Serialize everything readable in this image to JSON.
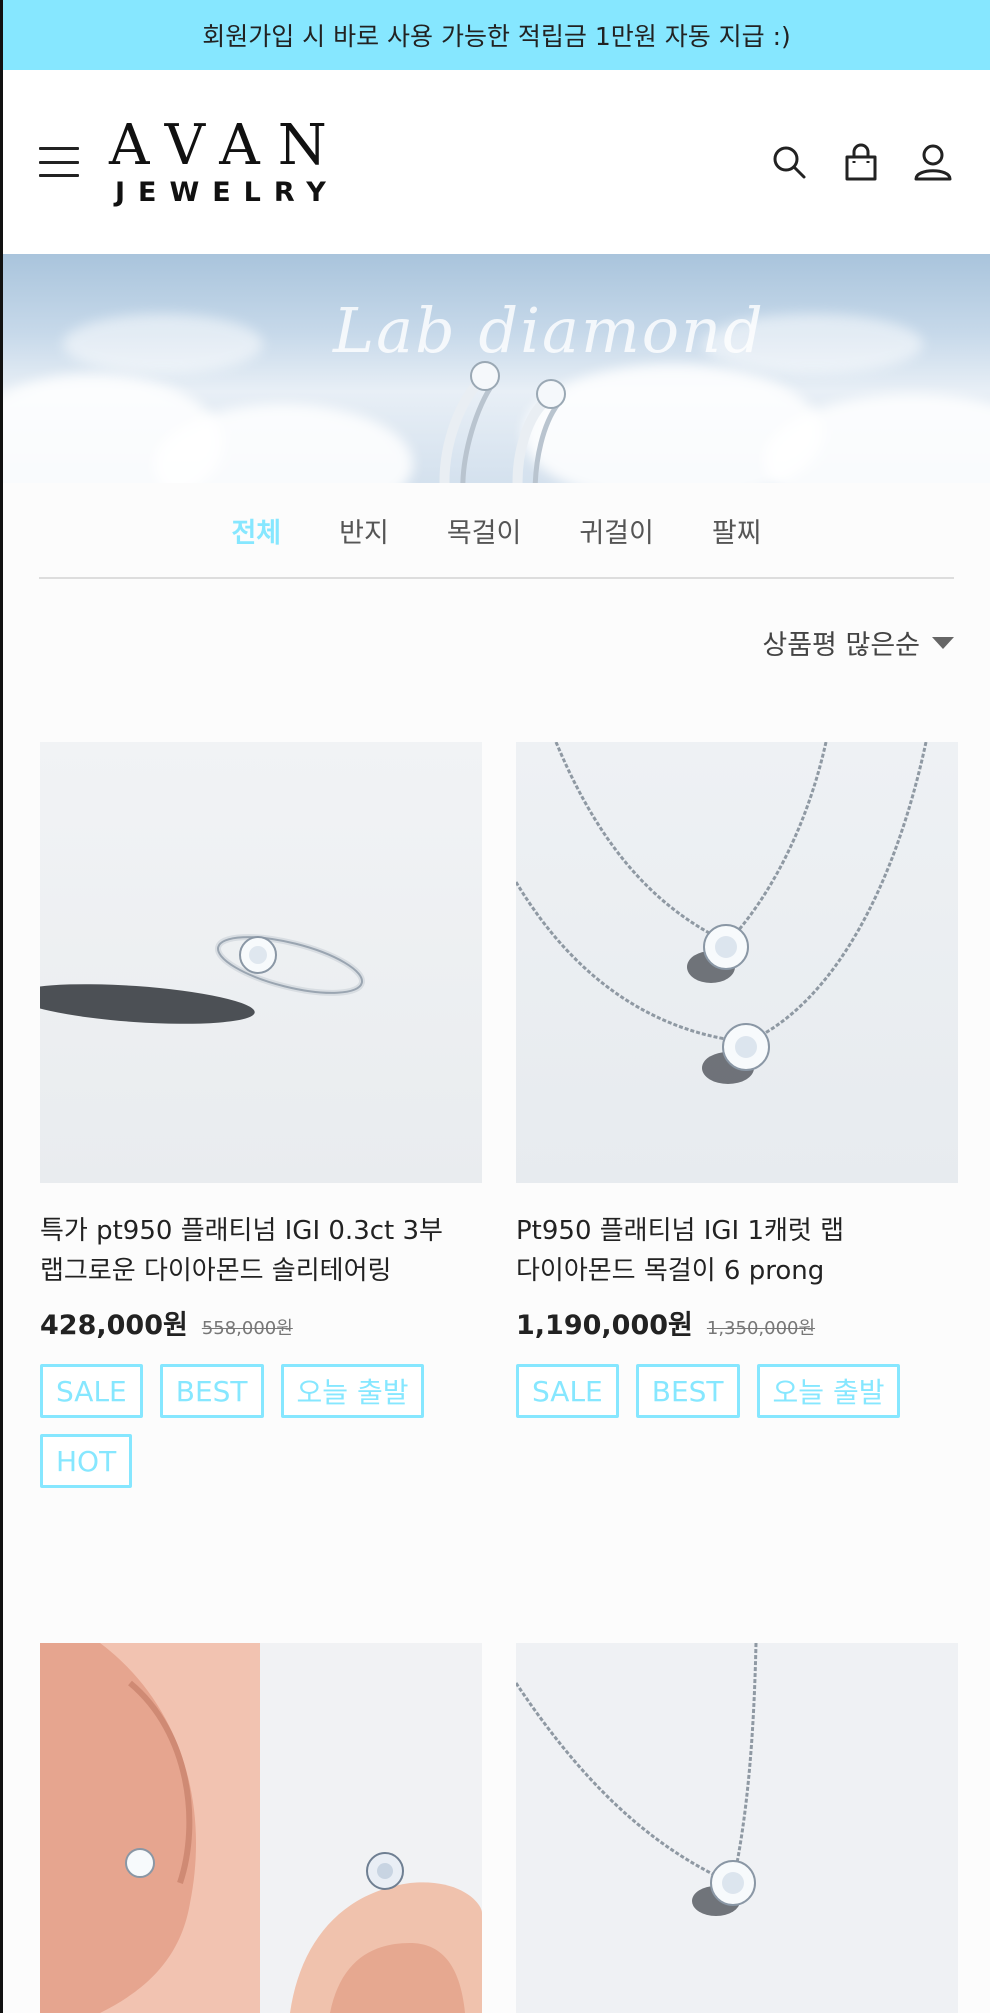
{
  "promo_bar": {
    "text": "회원가입 시 바로 사용 가능한 적립금 1만원 자동 지급 :)"
  },
  "header": {
    "logo_top": "AVAN",
    "logo_bottom": "JEWELRY",
    "icons": [
      "menu-icon",
      "search-icon",
      "shopping-bag-icon",
      "user-icon"
    ]
  },
  "banner": {
    "text": "Lab diamond"
  },
  "tabs": [
    {
      "label": "전체",
      "active": true
    },
    {
      "label": "반지",
      "active": false
    },
    {
      "label": "목걸이",
      "active": false
    },
    {
      "label": "귀걸이",
      "active": false
    },
    {
      "label": "팔찌",
      "active": false
    }
  ],
  "sort": {
    "label": "상품평 많은순"
  },
  "products": [
    {
      "title_line1": "특가 pt950 플래티넘 IGI 0.3ct 3부",
      "title_line2": "랩그로운 다이아몬드 솔리테어링",
      "price": "428,000원",
      "original_price": "558,000원",
      "badges": [
        "SALE",
        "BEST",
        "오늘 출발",
        "HOT"
      ]
    },
    {
      "title_line1": "Pt950 플래티넘 IGI 1캐럿 랩",
      "title_line2": "다이아몬드 목걸이 6 prong",
      "price": "1,190,000원",
      "original_price": "1,350,000원",
      "badges": [
        "SALE",
        "BEST",
        "오늘 출발"
      ]
    }
  ],
  "colors": {
    "accent": "#86e7ff",
    "text": "#222222",
    "background": "#fcfcfc"
  }
}
